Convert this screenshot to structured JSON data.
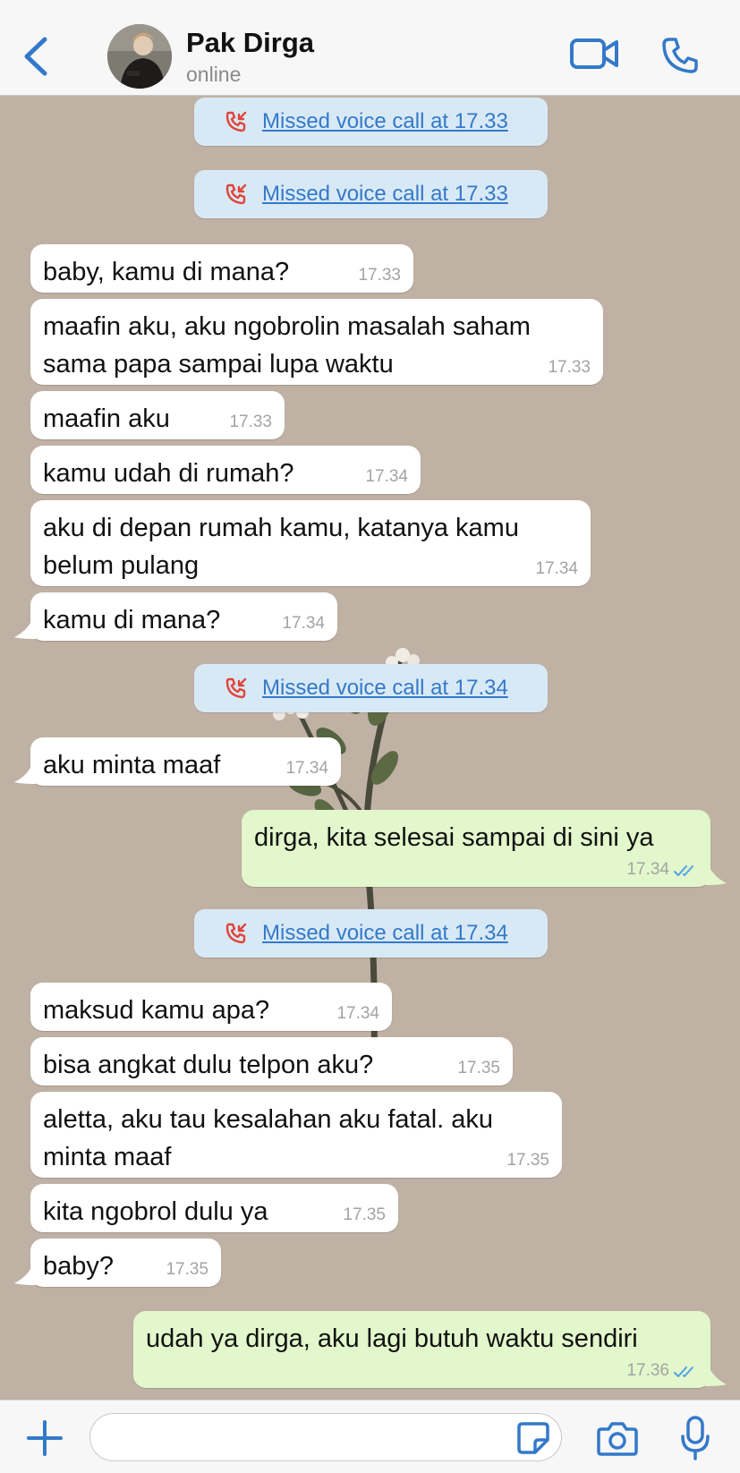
{
  "header": {
    "contact_name": "Pak Dirga",
    "status": "online",
    "icons": [
      "chevron-left-icon",
      "video-camera-icon",
      "phone-icon"
    ]
  },
  "messages": [
    {
      "type": "call",
      "text": "Missed voice call at 17.33"
    },
    {
      "type": "call",
      "text": "Missed voice call at 17.33"
    },
    {
      "type": "in",
      "lines": [
        "baby, kamu di mana?"
      ],
      "time": "17.33"
    },
    {
      "type": "in",
      "lines": [
        "maafin aku, aku ngobrolin masalah saham",
        "sama papa sampai lupa waktu"
      ],
      "time": "17.33"
    },
    {
      "type": "in",
      "lines": [
        "maafin aku"
      ],
      "time": "17.33"
    },
    {
      "type": "in",
      "lines": [
        "kamu udah di rumah?"
      ],
      "time": "17.34"
    },
    {
      "type": "in",
      "lines": [
        "aku di depan rumah kamu, katanya kamu",
        "belum pulang"
      ],
      "time": "17.34"
    },
    {
      "type": "in",
      "lines": [
        "kamu di mana?"
      ],
      "time": "17.34"
    },
    {
      "type": "call",
      "text": "Missed voice call at 17.34"
    },
    {
      "type": "in",
      "lines": [
        "aku minta maaf"
      ],
      "time": "17.34"
    },
    {
      "type": "out",
      "lines": [
        "dirga, kita selesai sampai di sini ya"
      ],
      "time": "17.34",
      "status": "read"
    },
    {
      "type": "call",
      "text": "Missed voice call at 17.34"
    },
    {
      "type": "in",
      "lines": [
        "maksud kamu apa?"
      ],
      "time": "17.34"
    },
    {
      "type": "in",
      "lines": [
        "bisa angkat dulu telpon aku?"
      ],
      "time": "17.35"
    },
    {
      "type": "in",
      "lines": [
        "aletta, aku tau kesalahan aku fatal. aku",
        "minta maaf"
      ],
      "time": "17.35"
    },
    {
      "type": "in",
      "lines": [
        "kita ngobrol dulu ya"
      ],
      "time": "17.35"
    },
    {
      "type": "in",
      "lines": [
        "baby?"
      ],
      "time": "17.35"
    },
    {
      "type": "out",
      "lines": [
        "udah ya dirga, aku lagi butuh waktu sendiri"
      ],
      "time": "17.36",
      "status": "read"
    }
  ],
  "input": {
    "value": "",
    "icons": [
      "plus-icon",
      "sticker-icon",
      "camera-icon",
      "microphone-icon"
    ]
  },
  "colors": {
    "wallpaper": "#c0b1a5",
    "incoming_bubble": "#ffffff",
    "outgoing_bubble": "#e2f7cb",
    "call_pill": "#d8e9f6",
    "accent": "#3479c9",
    "missed_call": "#e0453b",
    "read_ticks": "#4fa3e8"
  }
}
